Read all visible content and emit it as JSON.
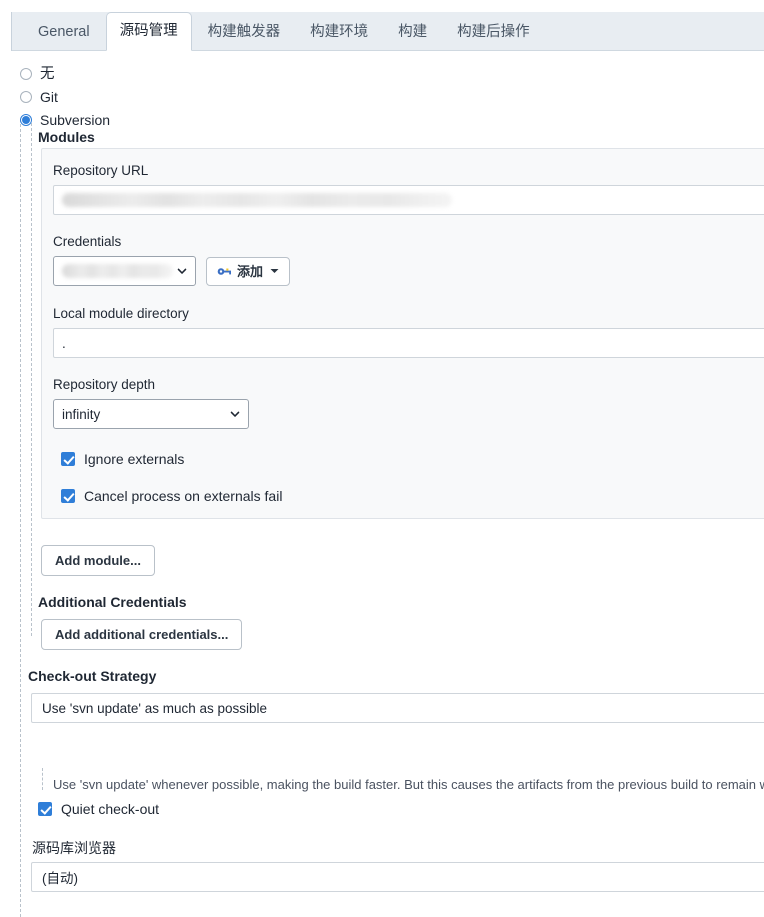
{
  "tabs": [
    {
      "label": "General",
      "active": false
    },
    {
      "label": "源码管理",
      "active": true
    },
    {
      "label": "构建触发器",
      "active": false
    },
    {
      "label": "构建环境",
      "active": false
    },
    {
      "label": "构建",
      "active": false
    },
    {
      "label": "构建后操作",
      "active": false
    }
  ],
  "scm_options": [
    {
      "label": "无",
      "selected": false
    },
    {
      "label": "Git",
      "selected": false
    },
    {
      "label": "Subversion",
      "selected": true
    }
  ],
  "modules": {
    "section_label": "Modules",
    "repository_url": {
      "label": "Repository URL",
      "value": "",
      "redacted": true
    },
    "credentials": {
      "label": "Credentials",
      "value": "",
      "redacted": true,
      "add_button": "添加",
      "add_icon": "key-icon",
      "caret_icon": "caret-down-icon"
    },
    "local_module_directory": {
      "label": "Local module directory",
      "value": "."
    },
    "repository_depth": {
      "label": "Repository depth",
      "value": "infinity"
    },
    "checkboxes": [
      {
        "label": "Ignore externals",
        "checked": true
      },
      {
        "label": "Cancel process on externals fail",
        "checked": true
      }
    ]
  },
  "add_module_button": "Add module...",
  "additional_credentials": {
    "label": "Additional Credentials",
    "button": "Add additional credentials..."
  },
  "checkout_strategy": {
    "label": "Check-out Strategy",
    "value": "Use 'svn update' as much as possible",
    "description": "Use 'svn update' whenever possible, making the build faster. But this causes the artifacts from the previous build to remain when",
    "quiet_checkout": {
      "label": "Quiet check-out",
      "checked": true
    }
  },
  "repository_browser": {
    "label": "源码库浏览器",
    "value": "(自动)"
  },
  "colors": {
    "accent": "#2f7ed8",
    "tabbar_bg": "#e8edf2",
    "panel_bg": "#f8f9fa"
  }
}
